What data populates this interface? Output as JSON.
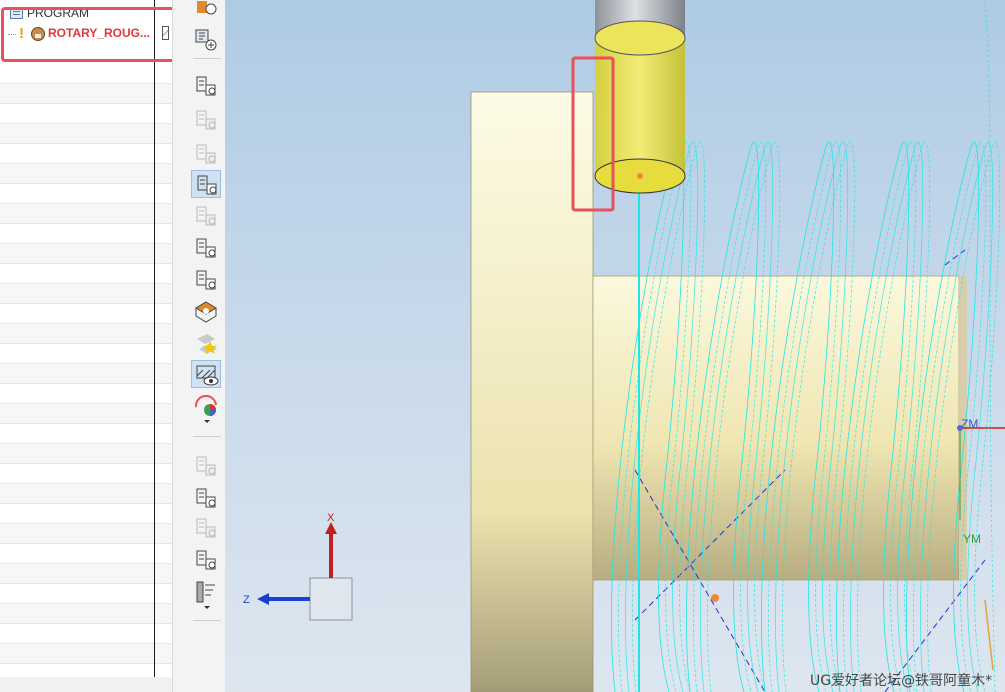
{
  "navigator": {
    "program_label": "PROGRAM",
    "operation_label": "ROTARY_ROUG...",
    "operation_warning": "!"
  },
  "toolbar": {
    "buttons": [
      "create-program-icon",
      "create-operation-icon",
      "replay-toolpath-icon",
      "regenerate-toolpath-icon",
      "list-toolpath-icon",
      "generate-toolpath-icon",
      "verify-toolpath-icon",
      "post-process-icon",
      "shop-documentation-icon",
      "material-removal-icon",
      "mark-complete-icon",
      "display-blank-icon",
      "color-palette-icon",
      "simulate-machine-icon",
      "check-toolpath-icon",
      "check-gouge-icon",
      "sync-manager-icon",
      "tool-holder-icon"
    ],
    "selected_button": "display-blank-icon"
  },
  "viewport": {
    "triad": {
      "x_label": "X",
      "z_label": "Z"
    },
    "wcs": {
      "zm_label": "ZM",
      "ym_label": "YM"
    },
    "colors": {
      "toolpath": "#1fe6e6",
      "tool_body": "#f2ea4a",
      "tool_shank": "#a9afb6",
      "workpiece": "#efe7b6",
      "highlight": "#e8505b"
    }
  },
  "watermark": "UG爱好者论坛@铁哥阿童木*"
}
